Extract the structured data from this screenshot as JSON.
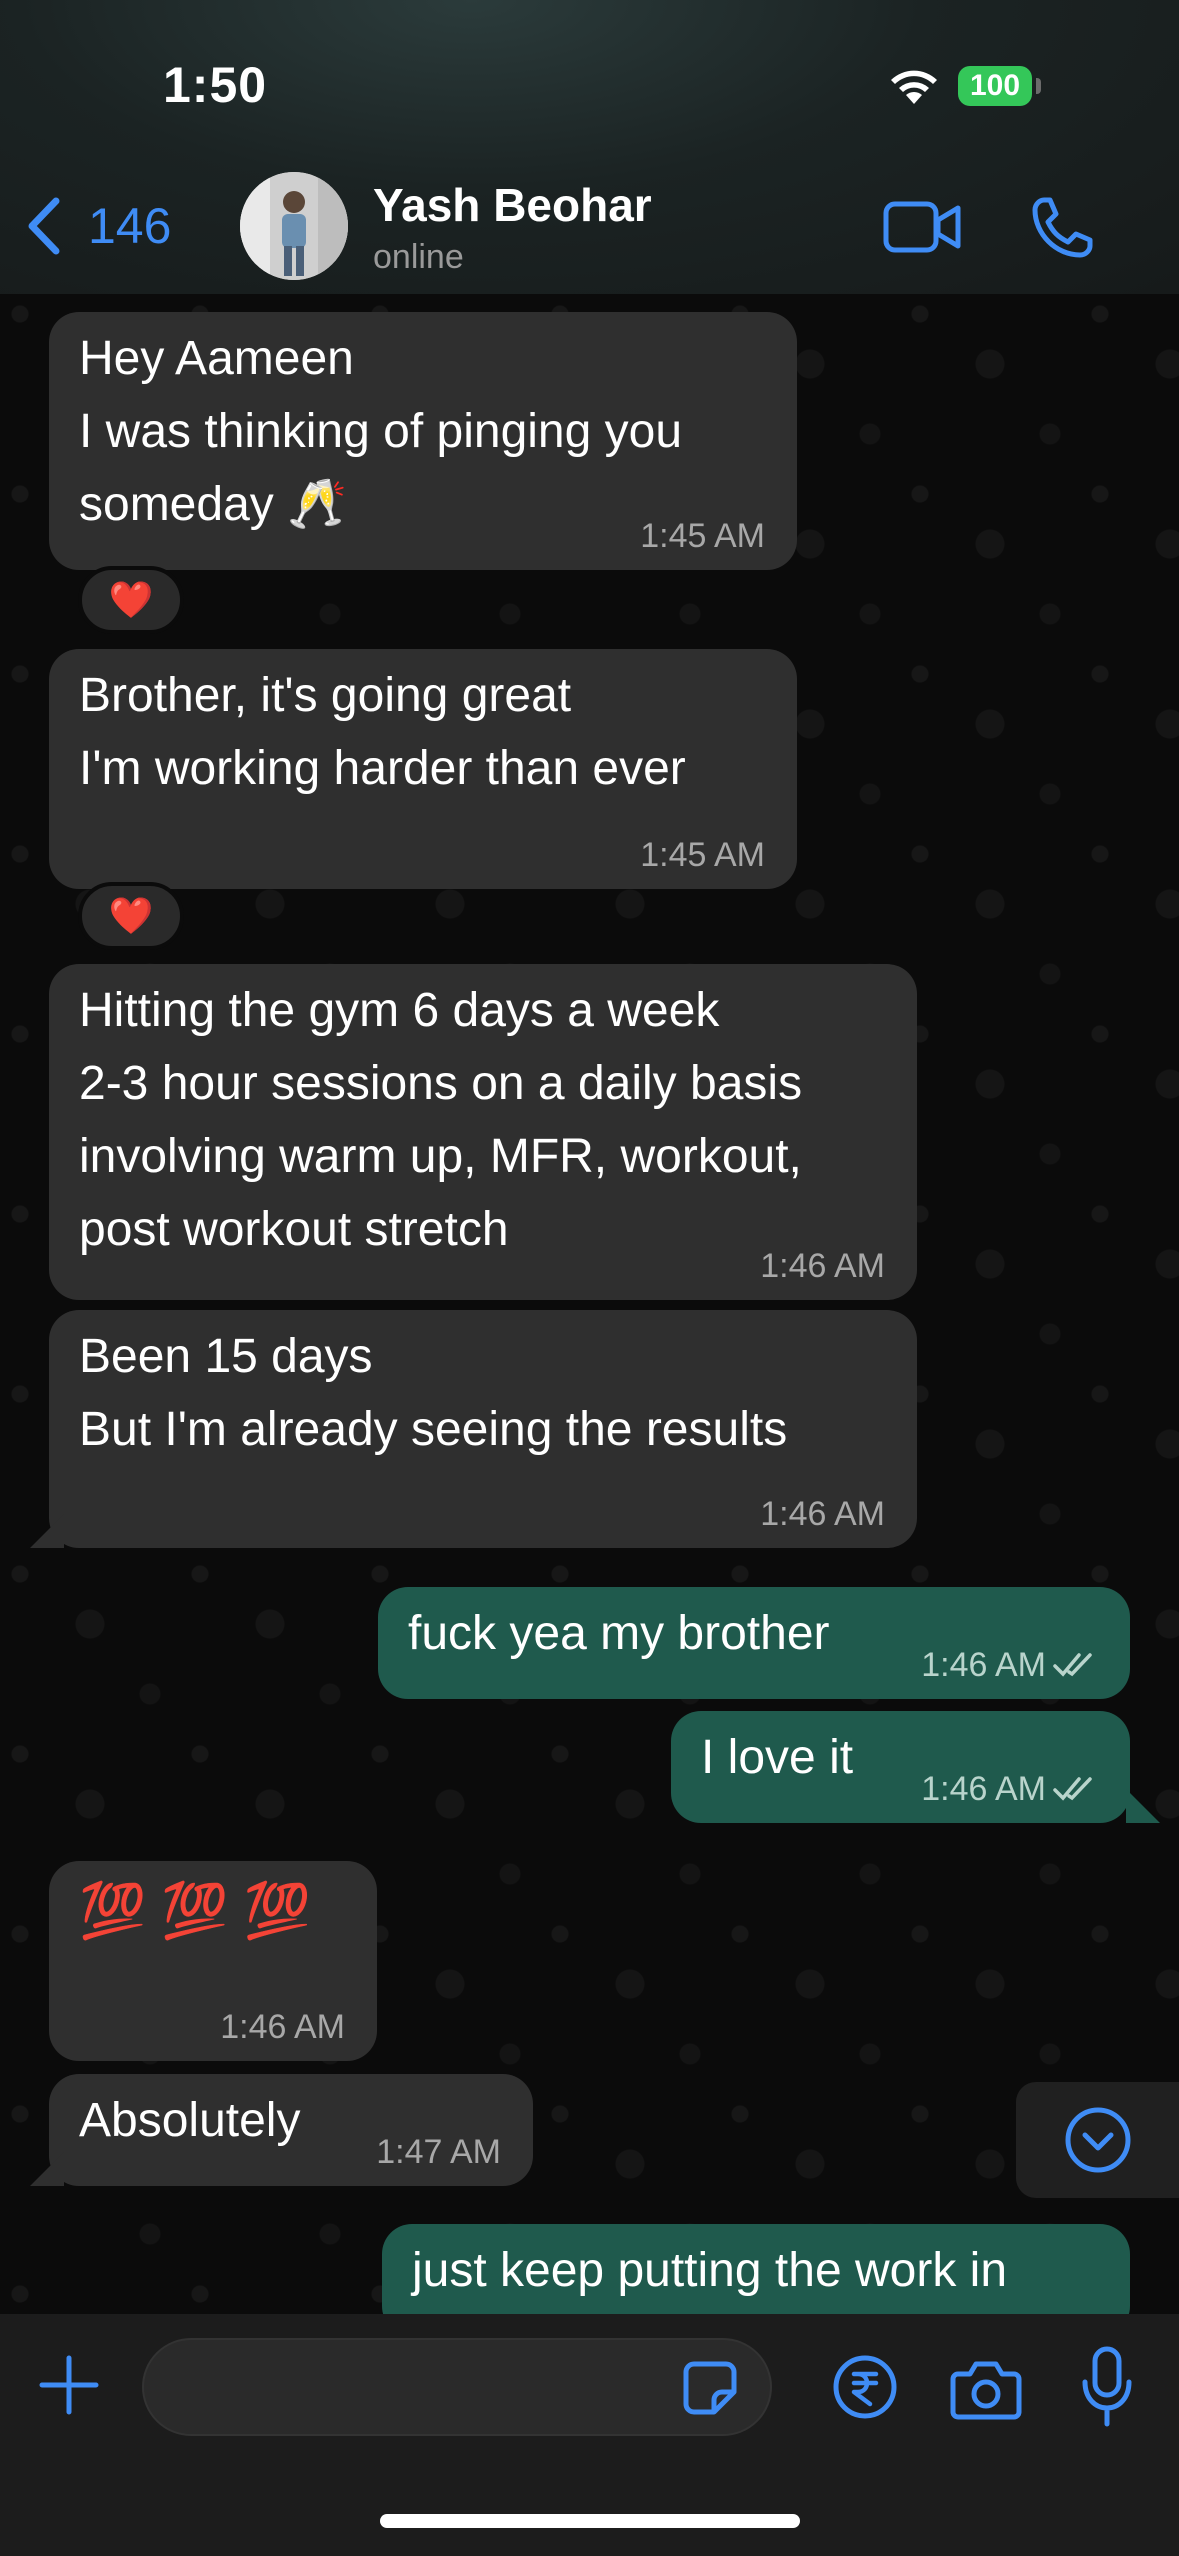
{
  "status_bar": {
    "time": "1:50",
    "battery": "100"
  },
  "header": {
    "back_count": "146",
    "contact_name": "Yash Beohar",
    "contact_status": "online"
  },
  "messages": [
    {
      "direction": "in",
      "text": "Hey Aameen\nI was thinking of pinging you\nsomeday 🥂",
      "time": "1:45 AM",
      "reaction": "❤️"
    },
    {
      "direction": "in",
      "text": "Brother, it's going great\nI'm working harder than ever",
      "time": "1:45 AM",
      "reaction": "❤️"
    },
    {
      "direction": "in",
      "text": "Hitting the gym 6 days a week\n2-3 hour sessions on a daily basis\ninvolving warm up, MFR, workout,\npost workout stretch",
      "time": "1:46 AM"
    },
    {
      "direction": "in",
      "text": "Been 15 days\nBut I'm already seeing the results",
      "time": "1:46 AM"
    },
    {
      "direction": "out",
      "text": "fuck yea my brother",
      "time": "1:46 AM",
      "status": "read"
    },
    {
      "direction": "out",
      "text": "I love it",
      "time": "1:46 AM",
      "status": "read"
    },
    {
      "direction": "in",
      "text": "💯 💯 💯",
      "time": "1:46 AM"
    },
    {
      "direction": "in",
      "text": "Absolutely",
      "time": "1:47 AM"
    },
    {
      "direction": "out",
      "text": "just keep putting the work in"
    }
  ],
  "input": {
    "placeholder": "",
    "value": ""
  },
  "colors": {
    "accent": "#3f8cf5",
    "incoming_bubble": "#2f2f2f",
    "outgoing_bubble": "#1f5a4d",
    "battery": "#34c759"
  },
  "icons": [
    "back-chevron-icon",
    "video-call-icon",
    "phone-call-icon",
    "plus-icon",
    "sticker-icon",
    "rupee-payment-icon",
    "camera-icon",
    "microphone-icon",
    "chevron-down-icon",
    "double-check-icon",
    "wifi-icon"
  ]
}
